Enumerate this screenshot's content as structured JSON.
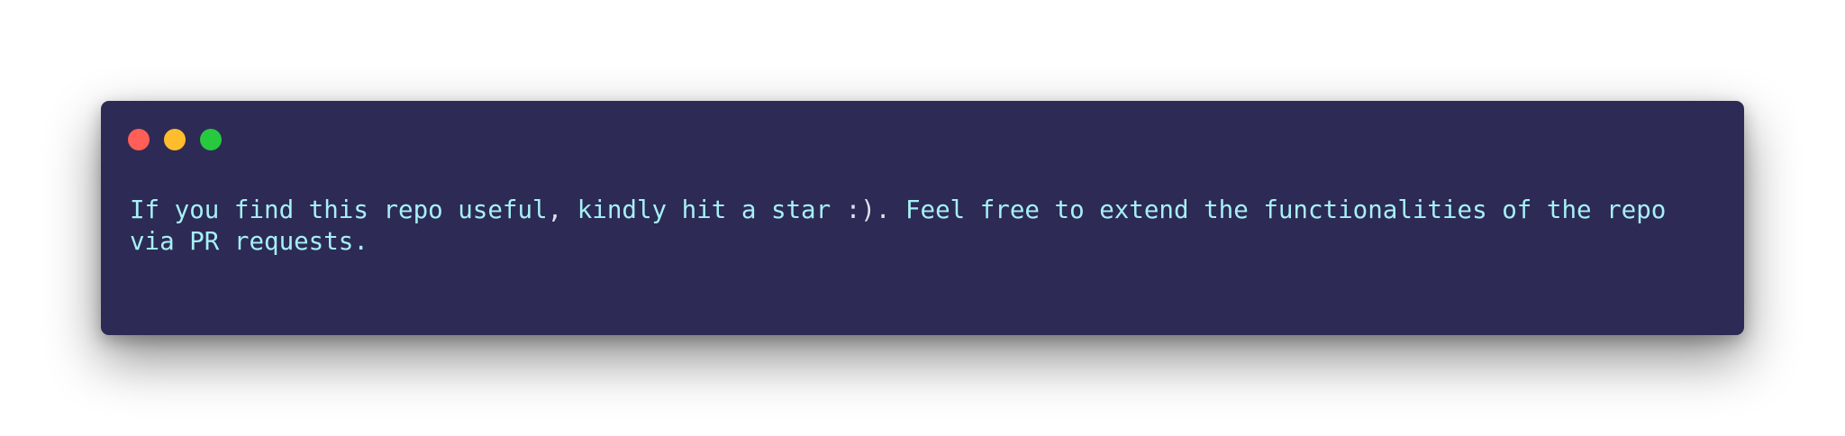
{
  "window": {
    "background": "#2d2a55",
    "controls": [
      {
        "name": "close",
        "color": "#ff5f56"
      },
      {
        "name": "minimize",
        "color": "#ffbd2e"
      },
      {
        "name": "zoom",
        "color": "#27c93f"
      }
    ]
  },
  "code": {
    "text_color": "#a6f0f6",
    "line1": {
      "part1": "If you find this repo useful",
      "part2": ",",
      "part3": " kindly hit a star ",
      "part4": ":).",
      "part5": " Feel free to extend the functionalities of the repo"
    },
    "line2": "via PR requests."
  }
}
